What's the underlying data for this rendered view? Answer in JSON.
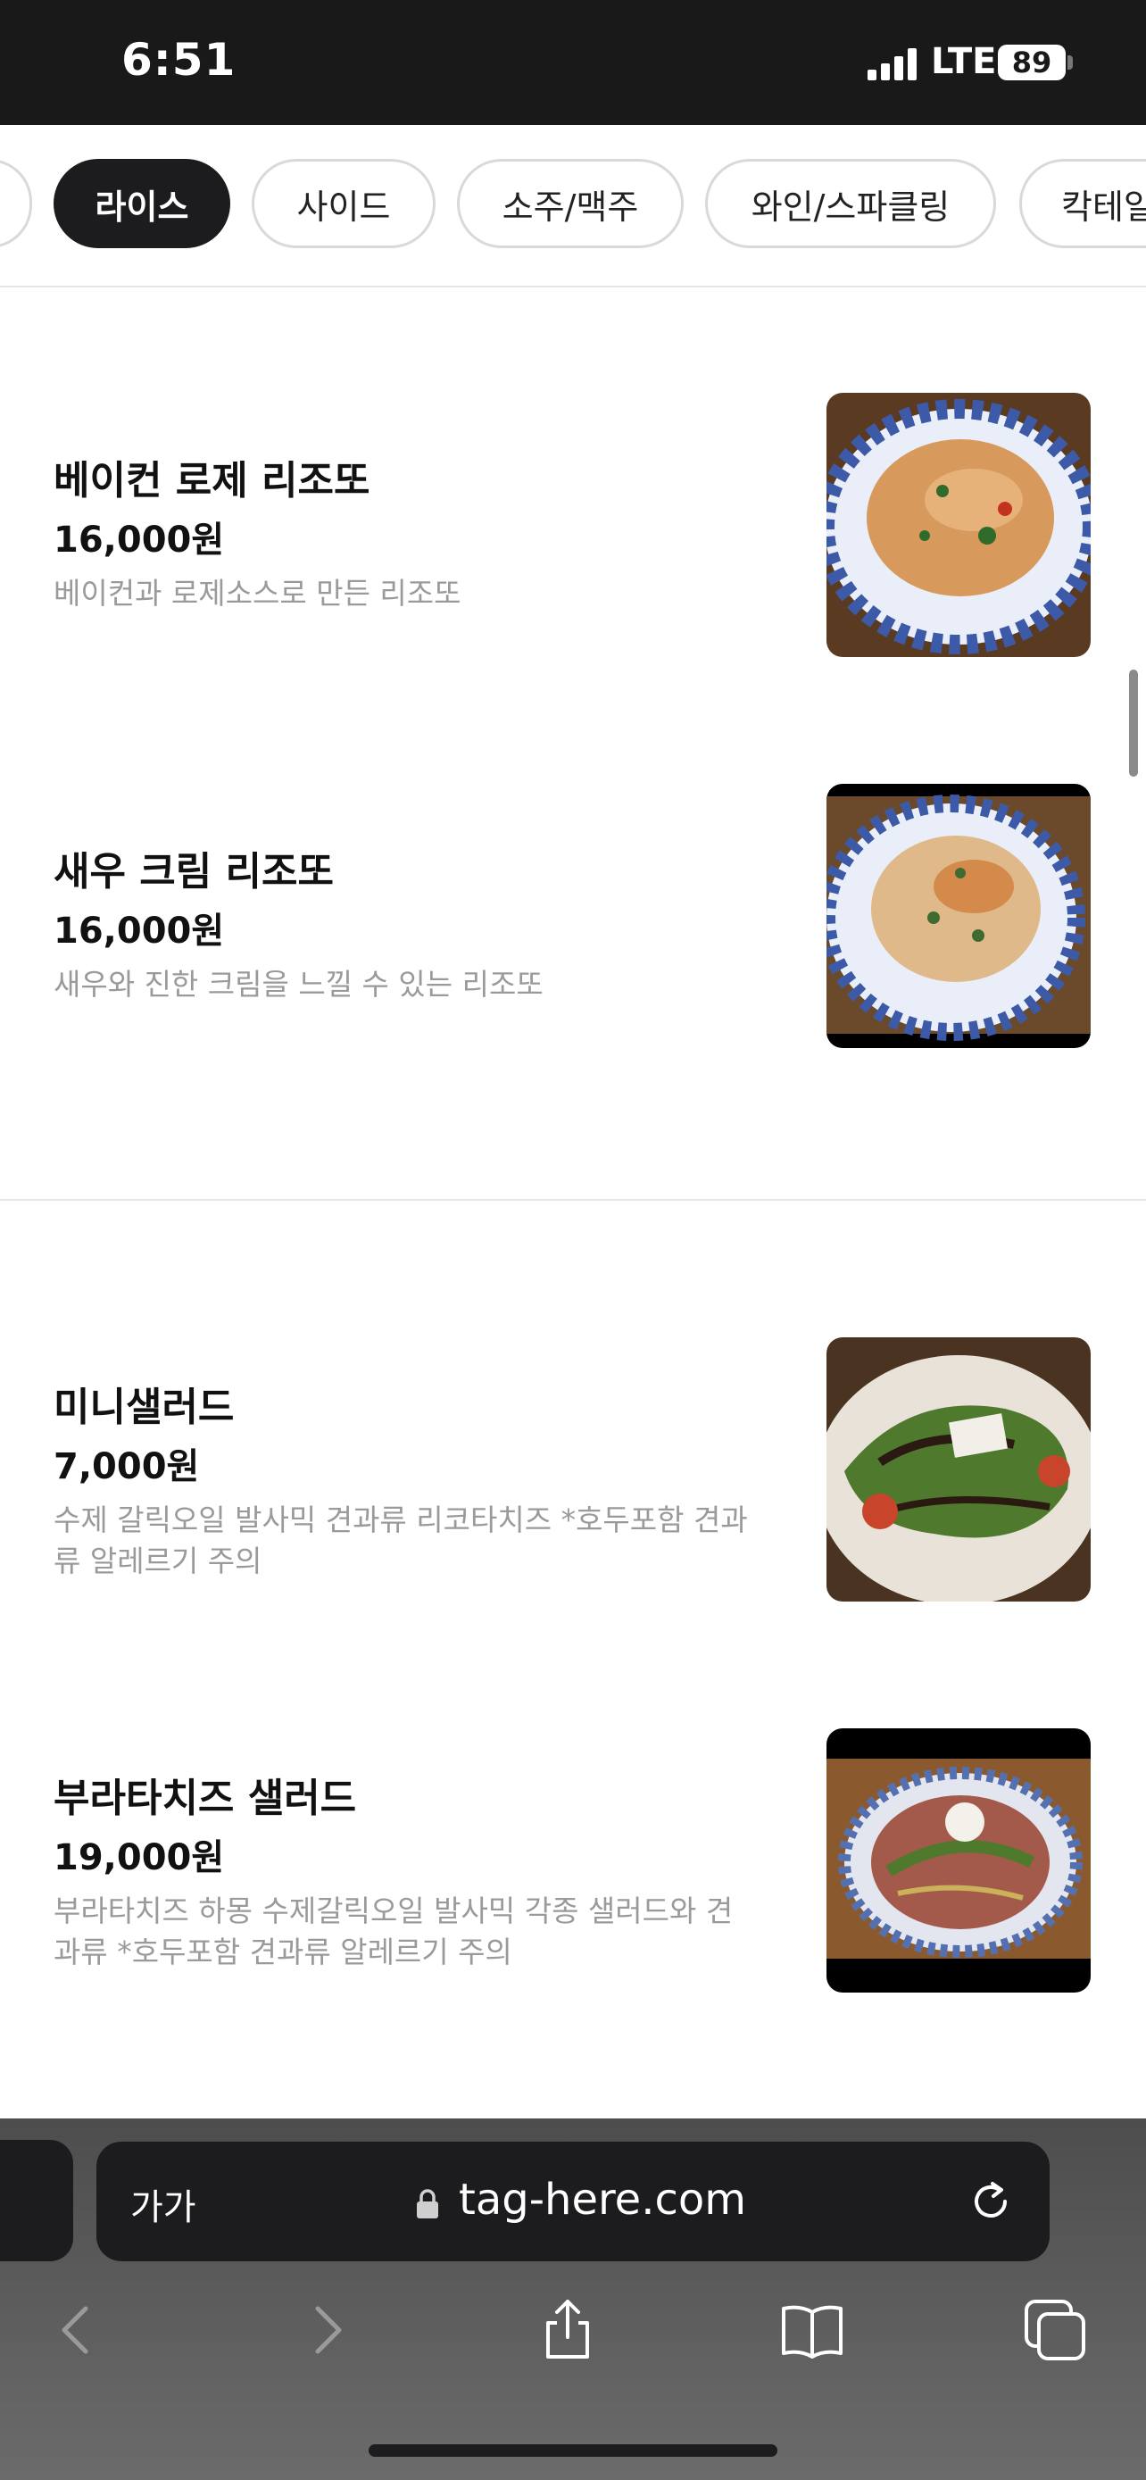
{
  "status_bar": {
    "time": "6:51",
    "network": "LTE",
    "battery": "89"
  },
  "categories": [
    {
      "label": "",
      "active": false
    },
    {
      "label": "라이스",
      "active": true
    },
    {
      "label": "사이드",
      "active": false
    },
    {
      "label": "소주/맥주",
      "active": false
    },
    {
      "label": "와인/스파클링",
      "active": false
    },
    {
      "label": "칵테일",
      "active": false
    }
  ],
  "menu_items": [
    {
      "name": "베이컨 로제 리조또",
      "price": "16,000원",
      "description": "베이컨과 로제소스로 만든 리조또"
    },
    {
      "name": "새우 크림 리조또",
      "price": "16,000원",
      "description": "새우와 진한 크림을 느낄 수 있는 리조또"
    },
    {
      "name": "미니샐러드",
      "price": "7,000원",
      "description": "수제 갈릭오일 발사믹 견과류 리코타치즈 *호두포함 견과류 알레르기 주의"
    },
    {
      "name": "부라타치즈 샐러드",
      "price": "19,000원",
      "description": "부라타치즈 하몽 수제갈릭오일 발사믹 각종 샐러드와 견과류 *호두포함 견과류 알레르기 주의"
    }
  ],
  "browser": {
    "text_size_button": "가가",
    "url": "tag-here.com"
  },
  "icons": {
    "signal": "signal-bars-icon",
    "battery": "battery-icon",
    "lock": "lock-icon",
    "reload": "reload-icon",
    "back": "chevron-left-icon",
    "forward": "chevron-right-icon",
    "share": "share-icon",
    "bookmarks": "book-icon",
    "tabs": "tabs-icon"
  },
  "colors": {
    "status_bar_bg": "#191919",
    "active_tab_bg": "#1c1c1e",
    "description_text": "#9a9a9a"
  }
}
